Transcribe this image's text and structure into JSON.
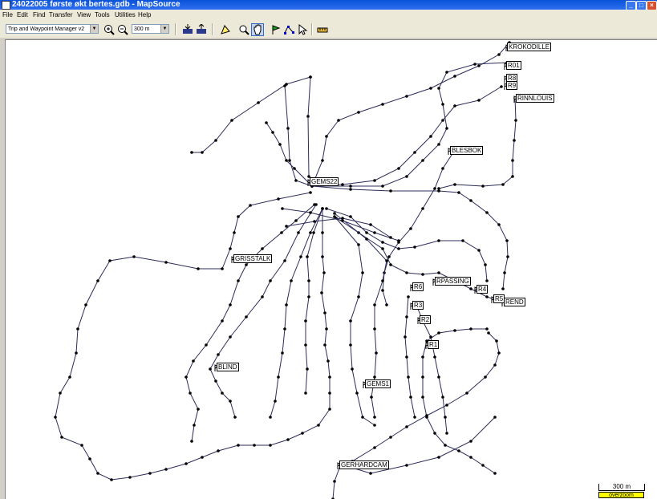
{
  "window": {
    "title": "24022005 første økt bertes.gdb - MapSource",
    "buttons": [
      "_",
      "□",
      "×"
    ]
  },
  "menu": [
    "File",
    "Edit",
    "Find",
    "Transfer",
    "View",
    "Tools",
    "Utilities",
    "Help"
  ],
  "toolbar": {
    "manager_select": "Trip and Waypoint Manager v2",
    "zoom_select": "300 m",
    "icons": [
      "zoom-in-icon",
      "zoom-out-icon",
      "receive-from-device-icon",
      "send-to-device-icon",
      "select-tool-icon",
      "zoom-tool-icon",
      "hand-pan-icon",
      "waypoint-tool-icon",
      "route-tool-icon",
      "pointer-icon",
      "measure-tool-icon"
    ]
  },
  "map": {
    "waypoints": [
      "KROKODILLE",
      "R01",
      "R8",
      "R9",
      "RINNLOUIS",
      "BLESBOK",
      "GEMS22",
      "GRISSTALK",
      "RPASSING",
      "R6",
      "R4",
      "R5",
      "REND",
      "R3",
      "R2",
      "R1",
      "BLIND",
      "GEMS1",
      "GERHARDCAM"
    ],
    "scale_label": "300 m",
    "overzoom_label": "overzoom"
  }
}
